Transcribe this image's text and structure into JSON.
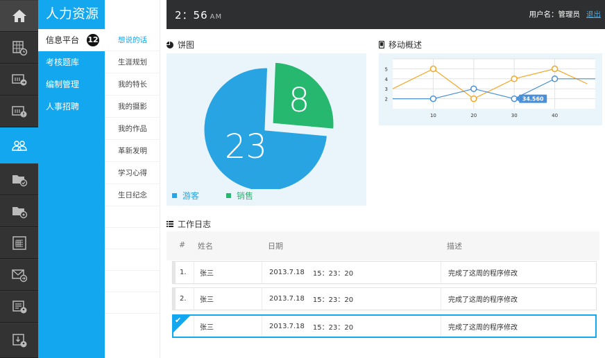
{
  "app": {
    "title": "人力资源"
  },
  "rail": {
    "items": [
      {
        "icon": "home-icon"
      },
      {
        "icon": "calendar-clock-icon"
      },
      {
        "icon": "forward-board-icon"
      },
      {
        "icon": "alert-board-icon"
      },
      {
        "icon": "users-icon",
        "active": true
      },
      {
        "icon": "folder-check-icon"
      },
      {
        "icon": "folder-settings-icon"
      },
      {
        "icon": "document-list-icon"
      },
      {
        "icon": "mail-forward-icon"
      },
      {
        "icon": "id-card-user-icon"
      },
      {
        "icon": "download-user-icon"
      }
    ]
  },
  "sidebar": {
    "items": [
      {
        "label": "信息平台",
        "badge": "12"
      },
      {
        "label": "考核题库"
      },
      {
        "label": "编制管理"
      },
      {
        "label": "人事招聘"
      }
    ]
  },
  "subnav": {
    "items": [
      {
        "label": "想说的话"
      },
      {
        "label": "生涯规划"
      },
      {
        "label": "我的特长"
      },
      {
        "label": "我的摄影"
      },
      {
        "label": "我的作品"
      },
      {
        "label": "革新发明"
      },
      {
        "label": "学习心得"
      },
      {
        "label": "生日纪念"
      }
    ]
  },
  "header": {
    "time": "2：56",
    "ampm": "AM",
    "user_label": "用户名：管理员",
    "logout": "退出"
  },
  "pie": {
    "title": "饼图",
    "legend": [
      {
        "label": "游客",
        "color": "#29a4e3"
      },
      {
        "label": "销售",
        "color": "#27b870"
      }
    ]
  },
  "line": {
    "title": "移动概述",
    "tooltip": "34.560"
  },
  "chart_data": [
    {
      "type": "pie",
      "title": "饼图",
      "slices": [
        {
          "label": "游客",
          "value": 23,
          "color": "#29a4e3"
        },
        {
          "label": "销售",
          "value": 8,
          "color": "#27b870"
        }
      ]
    },
    {
      "type": "line",
      "title": "移动概述",
      "xticks": [
        10,
        20,
        30,
        40
      ],
      "yticks": [
        2,
        3,
        4,
        5
      ],
      "xlim": [
        0,
        50
      ],
      "ylim": [
        1,
        6
      ],
      "grid": true,
      "series": [
        {
          "color": "#f5a623",
          "x": [
            0,
            10,
            20,
            30,
            40,
            48
          ],
          "y": [
            3,
            5,
            2,
            4,
            5,
            3.5
          ]
        },
        {
          "color": "#4a90d9",
          "x": [
            0,
            10,
            20,
            30,
            40,
            50
          ],
          "y": [
            2,
            2,
            3,
            2,
            4,
            4
          ]
        }
      ]
    }
  ],
  "log": {
    "title": "工作日志",
    "headers": [
      "#",
      "姓名",
      "日期",
      "描述"
    ],
    "rows": [
      {
        "num": "1.",
        "name": "张三",
        "date": "2013.7.18",
        "time": "15：23：20",
        "desc": "完成了这周的程序修改"
      },
      {
        "num": "2.",
        "name": "张三",
        "date": "2013.7.18",
        "time": "15：23：20",
        "desc": "完成了这周的程序修改"
      },
      {
        "num": "",
        "name": "张三",
        "date": "2013.7.18",
        "time": "15：23：20",
        "desc": "完成了这周的程序修改",
        "checked": true
      }
    ]
  }
}
